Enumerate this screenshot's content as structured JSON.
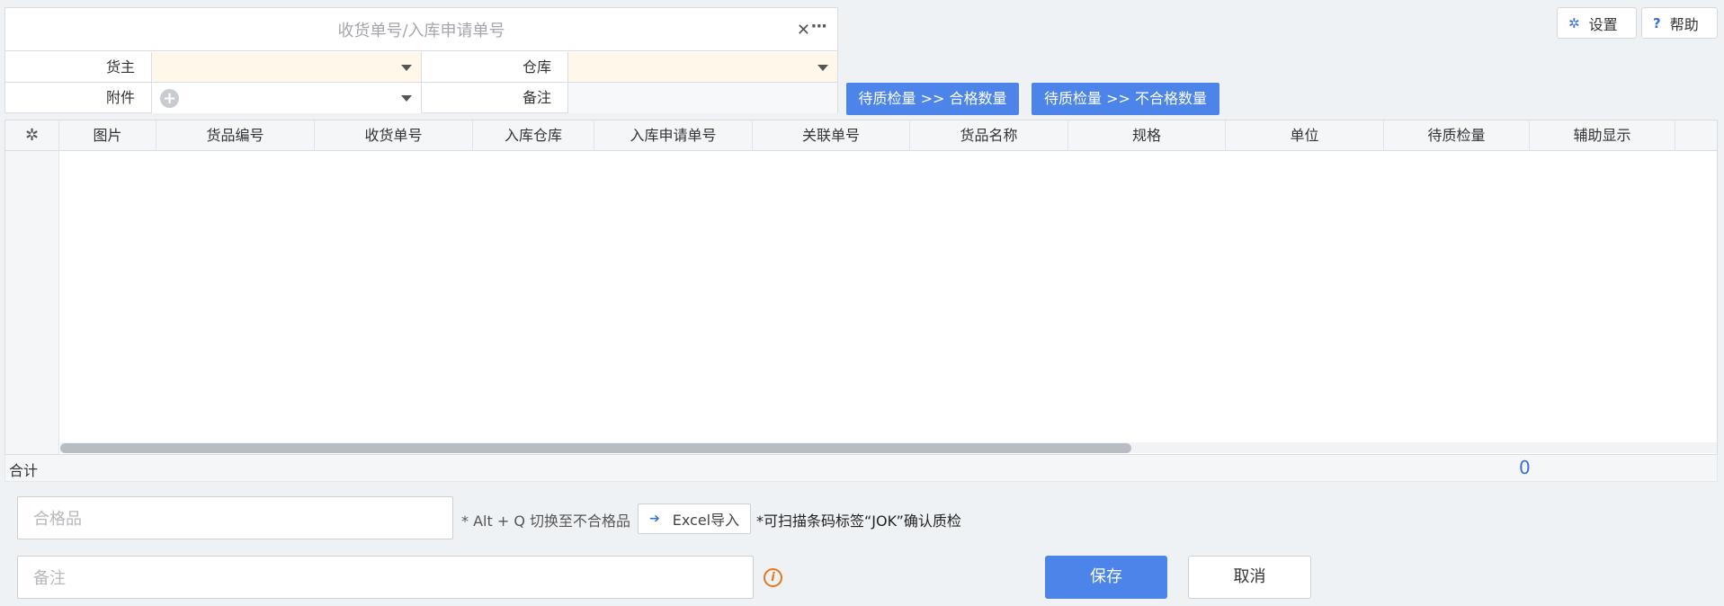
{
  "search": {
    "placeholder": "收货单号/入库申请单号",
    "clear_icon": "close-icon",
    "more_icon": "more-icon"
  },
  "form": {
    "owner_label": "货主",
    "warehouse_label": "仓库",
    "attachment_label": "附件",
    "remark_label": "备注"
  },
  "top_buttons": {
    "settings": "设置",
    "help": "帮助"
  },
  "actions": {
    "to_qualified": "待质检量 >> 合格数量",
    "to_unqualified": "待质检量 >> 不合格数量"
  },
  "grid": {
    "columns": [
      "图片",
      "货品编号",
      "收货单号",
      "入库仓库",
      "入库申请单号",
      "关联单号",
      "货品名称",
      "规格",
      "单位",
      "待质检量",
      "辅助显示"
    ],
    "rows": []
  },
  "total": {
    "label": "合计",
    "value": "0"
  },
  "bottom": {
    "qualified_placeholder": "合格品",
    "switch_hint": "* Alt + Q 切换至不合格品",
    "excel_import": "Excel导入",
    "scan_hint": "*可扫描条码标签“JOK”确认质检",
    "remark_placeholder": "备注",
    "save": "保存",
    "cancel": "取消"
  },
  "colors": {
    "accent": "#4c84e9",
    "required_bg": "#fff8ea",
    "info": "#e8761c"
  }
}
